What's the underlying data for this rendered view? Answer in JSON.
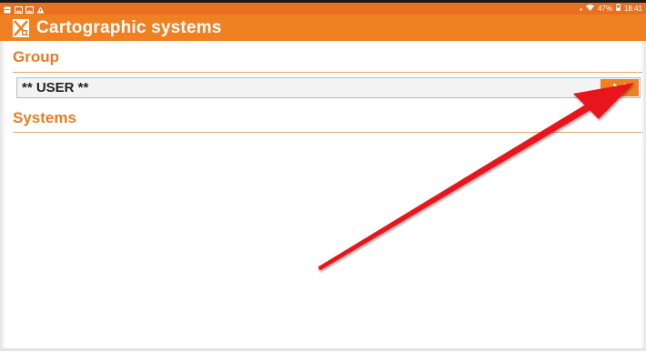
{
  "status_bar": {
    "battery": "47%",
    "time": "18:41",
    "left_icons": [
      "notification-icon",
      "photo-icon",
      "photo-icon",
      "warning-icon"
    ],
    "right_icons": [
      "dot-icon",
      "wifi-icon",
      "battery-icon"
    ]
  },
  "app_bar": {
    "title": "Cartographic systems",
    "logo": "app-logo-icon"
  },
  "group": {
    "heading": "Group",
    "selected_value": "** USER **",
    "dropdown_icon": "chevron-down-icon"
  },
  "systems": {
    "heading": "Systems",
    "items": []
  },
  "colors": {
    "accent": "#f08123",
    "heading": "#e87c22",
    "annotation_arrow": "#e8141b"
  }
}
